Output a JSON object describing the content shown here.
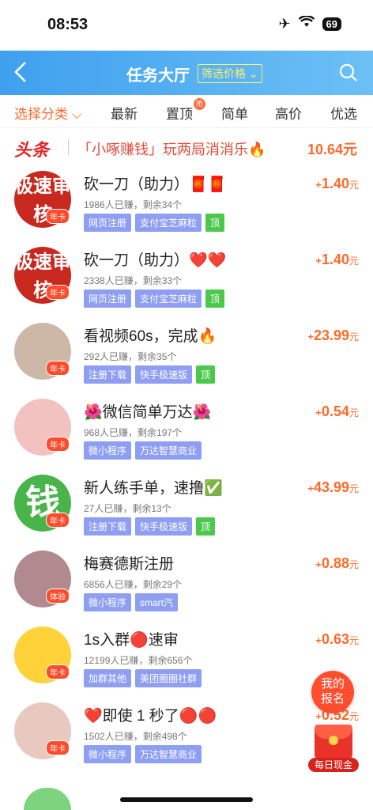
{
  "status": {
    "time": "08:53",
    "battery": "69"
  },
  "header": {
    "title": "任务大厅",
    "filter_label": "筛选价格"
  },
  "tabs": [
    {
      "label": "选择分类"
    },
    {
      "label": "最新"
    },
    {
      "label": "置顶",
      "badge": "抢"
    },
    {
      "label": "简单"
    },
    {
      "label": "高价"
    },
    {
      "label": "优选"
    }
  ],
  "headline": {
    "tag": "头条",
    "text": "「小啄赚钱」玩两局消消乐🔥",
    "price": "10.64元"
  },
  "tasks": [
    {
      "name": "砍一刀（助力）🧧🧧",
      "stats": "1986人已赚，剩余34个",
      "tags": [
        "网页注册",
        "支付宝芝麻粒",
        "顶"
      ],
      "price": "1.40",
      "avatar_text": "极速审核",
      "badge": "年卡",
      "color": "#c8281e"
    },
    {
      "name": "砍一刀（助力）❤️❤️",
      "stats": "2338人已赚，剩余33个",
      "tags": [
        "网页注册",
        "支付宝芝麻粒",
        "顶"
      ],
      "price": "1.40",
      "avatar_text": "极速审核",
      "badge": "年卡",
      "color": "#c8281e"
    },
    {
      "name": "看视频60s，完成🔥",
      "stats": "292人已赚，剩余35个",
      "tags": [
        "注册下载",
        "快手极速版",
        "顶"
      ],
      "price": "23.99",
      "avatar_text": "",
      "badge": "年卡",
      "color": "#cdb8a8"
    },
    {
      "name": "🌺微信简单万达🌺",
      "stats": "968人已赚，剩余197个",
      "tags": [
        "微小程序",
        "万达智慧商业"
      ],
      "price": "0.54",
      "avatar_text": "",
      "badge": "年卡",
      "color": "#f2c2c0"
    },
    {
      "name": "新人练手单，速撸✅",
      "stats": "27人已赚，剩余13个",
      "tags": [
        "注册下载",
        "快手极速版",
        "顶"
      ],
      "price": "43.99",
      "avatar_text": "钱",
      "badge": "年卡",
      "color": "#48b44a"
    },
    {
      "name": "梅赛德斯注册",
      "stats": "6856人已赚，剩余29个",
      "tags": [
        "微小程序",
        "smart汽"
      ],
      "price": "0.88",
      "avatar_text": "",
      "badge": "体验",
      "color": "#b08a8e"
    },
    {
      "name": "1s入群🔴速审",
      "stats": "12199人已赚，剩余656个",
      "tags": [
        "加群其他",
        "美团圈圈社群"
      ],
      "price": "0.63",
      "avatar_text": "",
      "badge": "年卡",
      "color": "#ffd23a"
    },
    {
      "name": "❤️即使 1 秒了🔴🔴",
      "stats": "1502人已赚，剩余498个",
      "tags": [
        "微小程序",
        "万达智慧商业"
      ],
      "price": "0.52",
      "avatar_text": "",
      "badge": "年卡",
      "color": "#e7c9c0"
    }
  ],
  "price_unit": "元",
  "price_prefix": "+",
  "floating": {
    "apply_label": "我的报名",
    "cash_label": "每日现金"
  }
}
